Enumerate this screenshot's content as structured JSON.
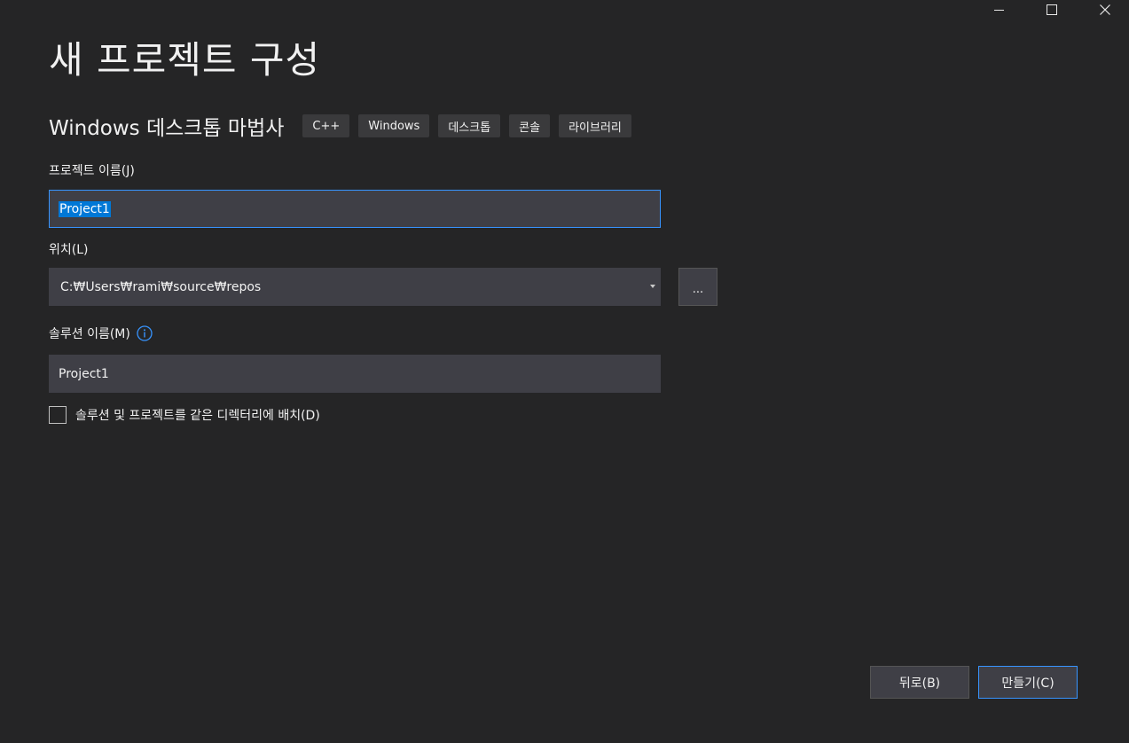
{
  "window_controls": {
    "minimize": "minimize-icon",
    "maximize": "maximize-icon",
    "close": "close-icon"
  },
  "page": {
    "title": "새 프로젝트 구성"
  },
  "template": {
    "name": "Windows 데스크톱 마법사",
    "tags": [
      "C++",
      "Windows",
      "데스크톱",
      "콘솔",
      "라이브러리"
    ]
  },
  "project_name": {
    "label": "프로젝트 이름(J)",
    "value": "Project1"
  },
  "location": {
    "label": "위치(L)",
    "value": "C:₩Users₩rami₩source₩repos",
    "browse_label": "..."
  },
  "solution_name": {
    "label": "솔루션 이름(M)",
    "value": "Project1",
    "info_icon": "info-icon"
  },
  "same_directory": {
    "label": "솔루션 및 프로젝트를 같은 디렉터리에 배치(D)",
    "checked": false
  },
  "footer": {
    "back_label": "뒤로(B)",
    "create_label": "만들기(C)"
  },
  "colors": {
    "background": "#252526",
    "input_background": "#3f3f46",
    "accent": "#3794ff",
    "selection": "#0078d7"
  }
}
